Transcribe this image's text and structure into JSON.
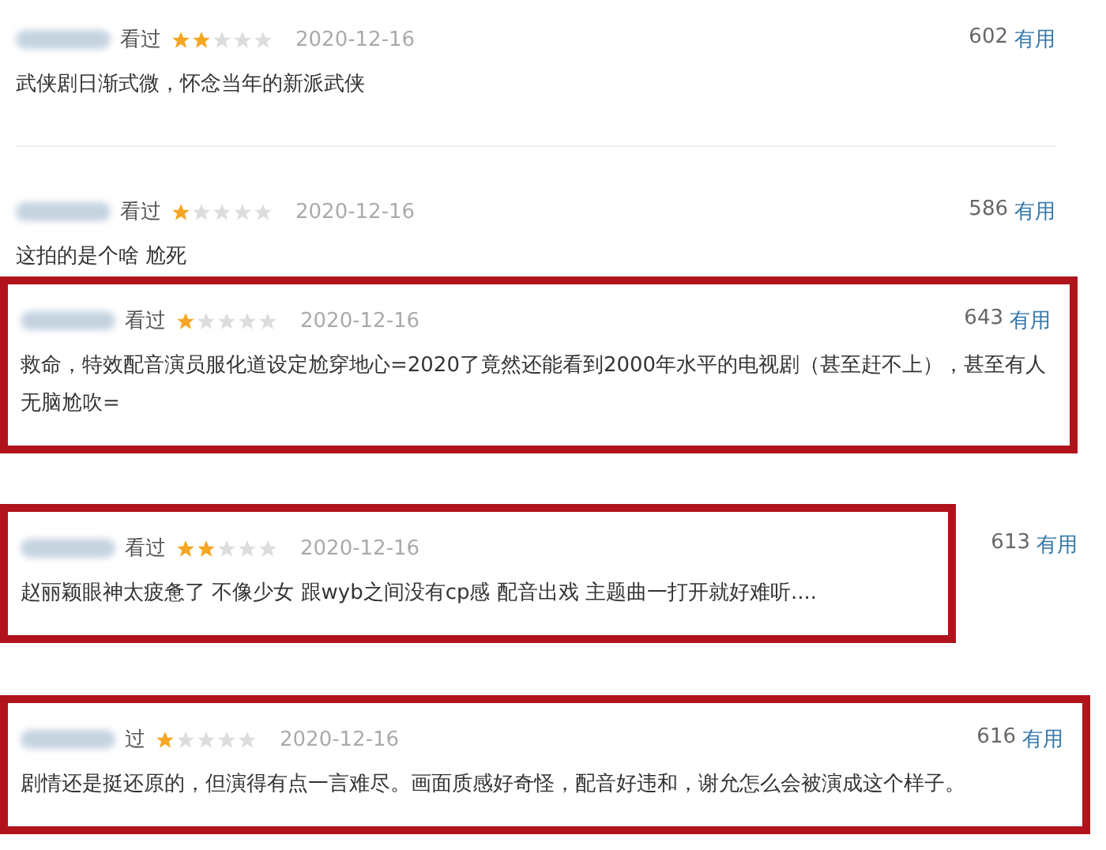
{
  "reviews": [
    {
      "watched": "看过",
      "stars": 2,
      "date": "2020-12-16",
      "votes": "602",
      "useful": "有用",
      "text": "武侠剧日渐式微，怀念当年的新派武侠",
      "kind": "plain",
      "divider": true
    },
    {
      "watched": "看过",
      "stars": 1,
      "date": "2020-12-16",
      "votes": "586",
      "useful": "有用",
      "text": "这拍的是个啥 尬死",
      "kind": "plain",
      "divider": false
    },
    {
      "watched": "看过",
      "stars": 1,
      "date": "2020-12-16",
      "votes": "643",
      "useful": "有用",
      "text": "救命，特效配音演员服化道设定尬穿地心=2020了竟然还能看到2000年水平的电视剧（甚至赶不上），甚至有人无脑尬吹=",
      "kind": "boxed",
      "divider": false
    },
    {
      "watched": "看过",
      "stars": 2,
      "date": "2020-12-16",
      "votes": "613",
      "useful": "有用",
      "text": "赵丽颖眼神太疲惫了 不像少女 跟wyb之间没有cp感 配音出戏 主题曲一打开就好难听....",
      "kind": "narrowbox",
      "divider": false
    },
    {
      "watched": "过",
      "stars": 1,
      "date": "2020-12-16",
      "votes": "616",
      "useful": "有用",
      "text": "剧情还是挺还原的，但演得有点一言难尽。画面质感好奇怪，配音好违和，谢允怎么会被演成这个样子。",
      "kind": "boxed",
      "divider": false
    }
  ]
}
